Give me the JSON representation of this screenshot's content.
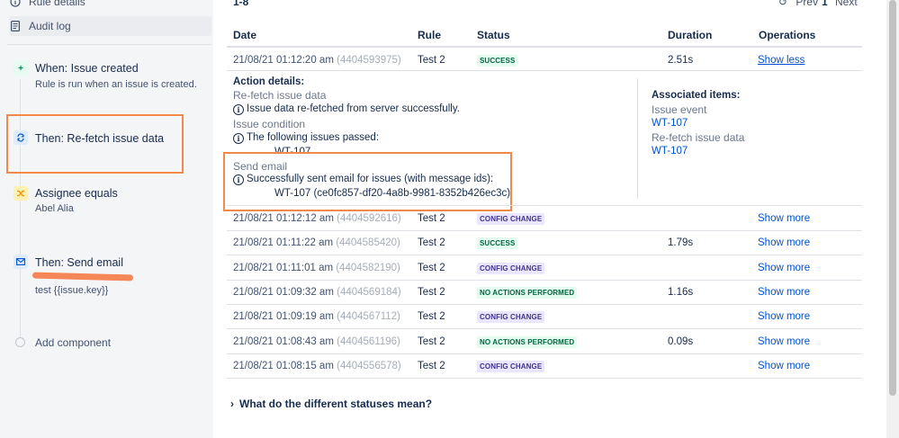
{
  "sidebar": {
    "rule_details": "Rule details",
    "audit_log": "Audit log",
    "components": [
      {
        "title": "When: Issue created",
        "subtitle": "Rule is run when an issue is created.",
        "icon": "plus-icon"
      },
      {
        "title": "Then: Re-fetch issue data",
        "subtitle": "",
        "icon": "refresh-icon"
      },
      {
        "title": "Assignee equals",
        "subtitle": "Abel Alia",
        "icon": "shuffle-icon"
      },
      {
        "title": "Then: Send email",
        "subtitle": "test {{issue.key}}",
        "icon": "mail-icon"
      }
    ],
    "add_component": "Add component"
  },
  "pagination": {
    "range": "1-8",
    "prev": "Prev",
    "page": "1",
    "next": "Next"
  },
  "table": {
    "headers": {
      "date": "Date",
      "rule": "Rule",
      "status": "Status",
      "duration": "Duration",
      "operations": "Operations"
    },
    "expanded": {
      "date": "21/08/21 01:12:20 am",
      "id": "(4404593975)",
      "rule": "Test 2",
      "status": "SUCCESS",
      "duration": "2.51s",
      "operation": "Show less"
    },
    "details": {
      "heading": "Action details:",
      "refetch_label": "Re-fetch issue data",
      "refetch_text": "Issue data re-fetched from server successfully.",
      "condition_label": "Issue condition",
      "condition_text": "The following issues passed:",
      "condition_issue": "WT-107",
      "email_label": "Send email",
      "email_text": "Successfully sent email for issues (with message ids):",
      "email_issue": "WT-107 (ce0fc857-df20-4a8b-9981-8352b426ec3c)",
      "associated_heading": "Associated items:",
      "issue_event_label": "Issue event",
      "issue_event_link": "WT-107",
      "refetch_assoc_label": "Re-fetch issue data",
      "refetch_assoc_link": "WT-107"
    },
    "rows": [
      {
        "date": "21/08/21 01:12:12 am",
        "id": "(4404592616)",
        "rule": "Test 2",
        "status": "CONFIG CHANGE",
        "duration": "",
        "operation": "Show more"
      },
      {
        "date": "21/08/21 01:11:22 am",
        "id": "(4404585420)",
        "rule": "Test 2",
        "status": "SUCCESS",
        "duration": "1.79s",
        "operation": "Show more"
      },
      {
        "date": "21/08/21 01:11:01 am",
        "id": "(4404582190)",
        "rule": "Test 2",
        "status": "CONFIG CHANGE",
        "duration": "",
        "operation": "Show more"
      },
      {
        "date": "21/08/21 01:09:32 am",
        "id": "(4404569184)",
        "rule": "Test 2",
        "status": "NO ACTIONS PERFORMED",
        "duration": "1.16s",
        "operation": "Show more"
      },
      {
        "date": "21/08/21 01:09:19 am",
        "id": "(4404567112)",
        "rule": "Test 2",
        "status": "CONFIG CHANGE",
        "duration": "",
        "operation": "Show more"
      },
      {
        "date": "21/08/21 01:08:43 am",
        "id": "(4404561196)",
        "rule": "Test 2",
        "status": "NO ACTIONS PERFORMED",
        "duration": "0.09s",
        "operation": "Show more"
      },
      {
        "date": "21/08/21 01:08:15 am",
        "id": "(4404556578)",
        "rule": "Test 2",
        "status": "CONFIG CHANGE",
        "duration": "",
        "operation": "Show more"
      }
    ]
  },
  "footer": {
    "statuses_link": "What do the different statuses mean?"
  },
  "colors": {
    "annotation": "#f08a4b",
    "link": "#0052cc",
    "success": "#006644",
    "config": "#403294"
  }
}
